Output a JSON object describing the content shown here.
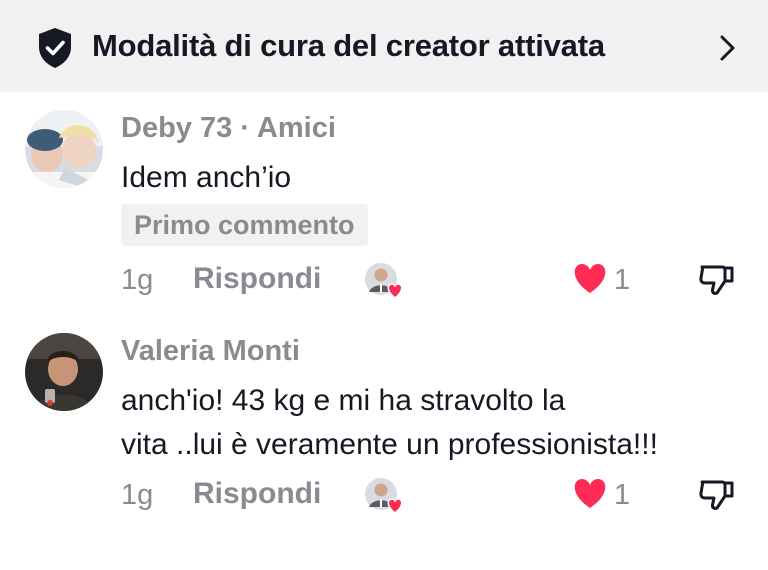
{
  "banner": {
    "title": "Modalità di cura del creator attivata",
    "icon": "shield-check-icon",
    "chevron": "chevron-right-icon"
  },
  "comments": [
    {
      "name": "Deby 73 · Amici",
      "text_lines": [
        "Idem anch’io"
      ],
      "badge": "Primo commento",
      "time": "1g",
      "reply_label": "Rispondi",
      "likes": "1"
    },
    {
      "name": "Valeria Monti",
      "text_lines": [
        "anch'io! 43 kg e mi ha stravolto la",
        "vita ..lui è veramente un professionista!!!"
      ],
      "time": "1g",
      "reply_label": "Rispondi",
      "likes": "1"
    }
  ],
  "colors": {
    "banner_bg": "#f1f1f2",
    "text_primary": "#161823",
    "text_secondary": "#8a8b91",
    "like": "#fe2c55"
  }
}
